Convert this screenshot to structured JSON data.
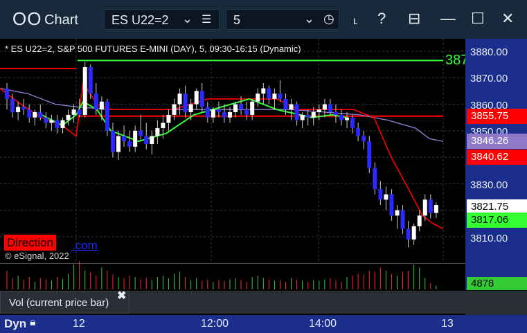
{
  "titlebar": {
    "logo": "OO",
    "title": "Chart",
    "symbol": "ES U22=2",
    "interval": "5",
    "icons": [
      "chevron-down-icon",
      "list-icon",
      "clock-icon",
      "draw-icon",
      "help-icon",
      "template-icon",
      "maximize-icon",
      "close-icon"
    ]
  },
  "chart_header": "* ES U22=2, S&P 500 FUTURES E-MINI (DAY), 5, 09:30-16:15 (Dynamic)",
  "copyright": "© eSignal, 2022",
  "direction_label": "Direction",
  "direction_suffix": ".com",
  "truncated_label": "387",
  "vol_label": "Vol (current price bar)",
  "vol_close": "✖",
  "bottom": {
    "mode": "Dyn",
    "time_ticks": [
      "12",
      "12:00",
      "14:00",
      "13"
    ]
  },
  "axis": {
    "ticks": [
      "3880.00",
      "3870.00",
      "3860.00",
      "3850.00",
      "3830.00",
      "3810.00"
    ],
    "tags": [
      {
        "text": "3855.75",
        "bg": "#ff0000",
        "fg": "#ffffff"
      },
      {
        "text": "3846.26",
        "bg": "#8f79c9",
        "fg": "#ffffff"
      },
      {
        "text": "3840.62",
        "bg": "#ff0000",
        "fg": "#ffffff"
      },
      {
        "text": "3821.75",
        "bg": "#ffffff",
        "fg": "#000000"
      },
      {
        "text": "3817.06",
        "bg": "#33ff33",
        "fg": "#000000"
      }
    ],
    "volume": "4878"
  },
  "colors": {
    "up": "#ffffff",
    "down": "#2a2aff",
    "wick": "#cccccc",
    "red_line": "#ff0000",
    "green_line": "#33ff33",
    "purple_line": "#8f79c9",
    "grid": "#3a3a3a"
  },
  "chart_data": {
    "type": "candlestick",
    "ylim": [
      3805,
      3885
    ],
    "y_ticks": [
      3880,
      3870,
      3860,
      3850,
      3830,
      3810
    ],
    "candles": [
      [
        3866,
        3868,
        3858,
        3862
      ],
      [
        3862,
        3864,
        3855,
        3857
      ],
      [
        3857,
        3861,
        3854,
        3859
      ],
      [
        3859,
        3862,
        3856,
        3858
      ],
      [
        3858,
        3860,
        3853,
        3855
      ],
      [
        3855,
        3858,
        3852,
        3857
      ],
      [
        3857,
        3860,
        3854,
        3855
      ],
      [
        3855,
        3857,
        3851,
        3853
      ],
      [
        3853,
        3856,
        3850,
        3854
      ],
      [
        3854,
        3856,
        3849,
        3851
      ],
      [
        3851,
        3855,
        3849,
        3854
      ],
      [
        3854,
        3858,
        3852,
        3856
      ],
      [
        3856,
        3860,
        3853,
        3858
      ],
      [
        3858,
        3862,
        3855,
        3856
      ],
      [
        3856,
        3876,
        3855,
        3874
      ],
      [
        3874,
        3875,
        3862,
        3864
      ],
      [
        3864,
        3868,
        3856,
        3858
      ],
      [
        3858,
        3863,
        3854,
        3861
      ],
      [
        3861,
        3862,
        3848,
        3850
      ],
      [
        3850,
        3853,
        3840,
        3842
      ],
      [
        3842,
        3850,
        3839,
        3848
      ],
      [
        3848,
        3852,
        3844,
        3846
      ],
      [
        3846,
        3850,
        3842,
        3844
      ],
      [
        3844,
        3852,
        3842,
        3850
      ],
      [
        3850,
        3856,
        3846,
        3848
      ],
      [
        3848,
        3853,
        3843,
        3845
      ],
      [
        3845,
        3850,
        3841,
        3848
      ],
      [
        3848,
        3854,
        3845,
        3851
      ],
      [
        3851,
        3856,
        3847,
        3853
      ],
      [
        3853,
        3858,
        3850,
        3856
      ],
      [
        3856,
        3862,
        3854,
        3860
      ],
      [
        3860,
        3866,
        3856,
        3864
      ],
      [
        3864,
        3867,
        3855,
        3857
      ],
      [
        3857,
        3862,
        3854,
        3860
      ],
      [
        3860,
        3866,
        3858,
        3865
      ],
      [
        3865,
        3868,
        3857,
        3859
      ],
      [
        3859,
        3861,
        3853,
        3855
      ],
      [
        3855,
        3859,
        3853,
        3858
      ],
      [
        3858,
        3861,
        3855,
        3857
      ],
      [
        3857,
        3860,
        3853,
        3855
      ],
      [
        3855,
        3859,
        3853,
        3857
      ],
      [
        3857,
        3861,
        3855,
        3860
      ],
      [
        3860,
        3863,
        3856,
        3858
      ],
      [
        3858,
        3861,
        3854,
        3856
      ],
      [
        3856,
        3862,
        3854,
        3861
      ],
      [
        3861,
        3866,
        3859,
        3864
      ],
      [
        3864,
        3868,
        3860,
        3866
      ],
      [
        3866,
        3867,
        3860,
        3862
      ],
      [
        3862,
        3866,
        3858,
        3864
      ],
      [
        3864,
        3869,
        3861,
        3862
      ],
      [
        3862,
        3864,
        3856,
        3858
      ],
      [
        3858,
        3862,
        3854,
        3860
      ],
      [
        3860,
        3861,
        3852,
        3854
      ],
      [
        3854,
        3857,
        3851,
        3856
      ],
      [
        3856,
        3858,
        3852,
        3855
      ],
      [
        3855,
        3859,
        3852,
        3857
      ],
      [
        3857,
        3860,
        3854,
        3858
      ],
      [
        3858,
        3862,
        3855,
        3860
      ],
      [
        3860,
        3862,
        3856,
        3857
      ],
      [
        3857,
        3860,
        3853,
        3856
      ],
      [
        3856,
        3858,
        3852,
        3854
      ],
      [
        3854,
        3857,
        3851,
        3855
      ],
      [
        3855,
        3856,
        3849,
        3851
      ],
      [
        3851,
        3853,
        3846,
        3848
      ],
      [
        3848,
        3850,
        3843,
        3846
      ],
      [
        3846,
        3848,
        3834,
        3836
      ],
      [
        3836,
        3838,
        3826,
        3828
      ],
      [
        3828,
        3831,
        3822,
        3824
      ],
      [
        3824,
        3829,
        3820,
        3826
      ],
      [
        3826,
        3828,
        3816,
        3818
      ],
      [
        3818,
        3822,
        3813,
        3820
      ],
      [
        3820,
        3822,
        3811,
        3813
      ],
      [
        3813,
        3816,
        3806,
        3809
      ],
      [
        3809,
        3815,
        3807,
        3814
      ],
      [
        3814,
        3820,
        3812,
        3818
      ],
      [
        3818,
        3826,
        3816,
        3824
      ],
      [
        3824,
        3826,
        3817,
        3819
      ],
      [
        3819,
        3823,
        3817,
        3822
      ]
    ],
    "volumes": [
      30,
      18,
      22,
      15,
      20,
      12,
      18,
      16,
      14,
      20,
      17,
      25,
      40,
      45,
      30,
      28,
      22,
      35,
      30,
      24,
      20,
      18,
      22,
      20,
      16,
      18,
      15,
      20,
      22,
      18,
      25,
      28,
      20,
      15,
      18,
      14,
      16,
      12,
      15,
      14,
      16,
      18,
      15,
      12,
      20,
      22,
      18,
      16,
      14,
      15,
      12,
      18,
      16,
      14,
      12,
      15,
      14,
      16,
      18,
      15,
      12,
      20,
      22,
      25,
      24,
      30,
      28,
      35,
      30,
      25,
      22,
      28,
      30,
      40,
      35,
      18,
      10,
      6
    ]
  }
}
